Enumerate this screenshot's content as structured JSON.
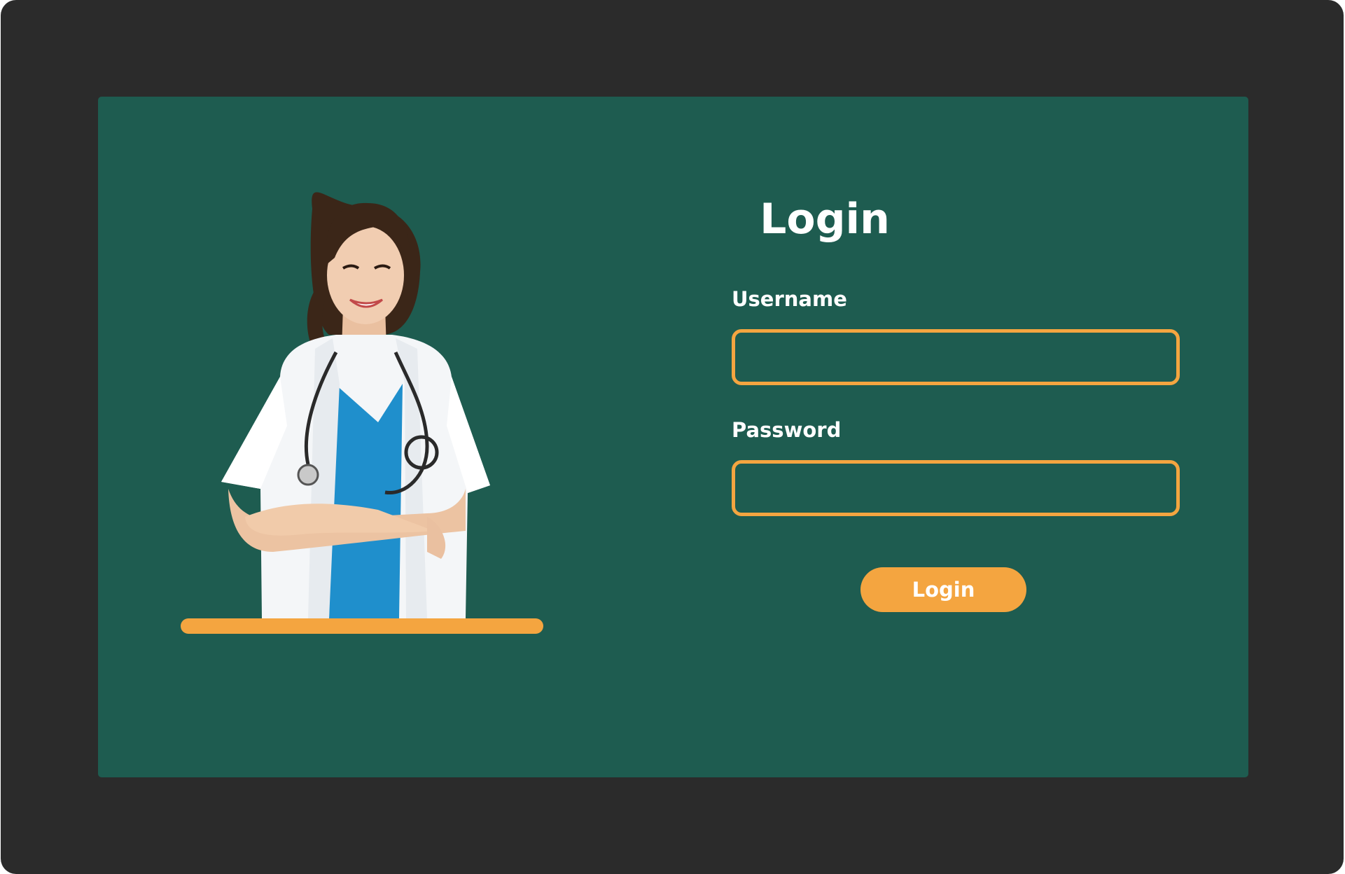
{
  "login_form": {
    "title": "Login",
    "username_label": "Username",
    "username_value": "",
    "password_label": "Password",
    "password_value": "",
    "submit_label": "Login"
  },
  "illustration": {
    "subject": "doctor-photo",
    "icon": "doctor-with-stethoscope"
  },
  "colors": {
    "page_frame": "#2b2b2b",
    "panel_bg": "#1e5c50",
    "accent": "#f4a540",
    "text": "#ffffff"
  }
}
